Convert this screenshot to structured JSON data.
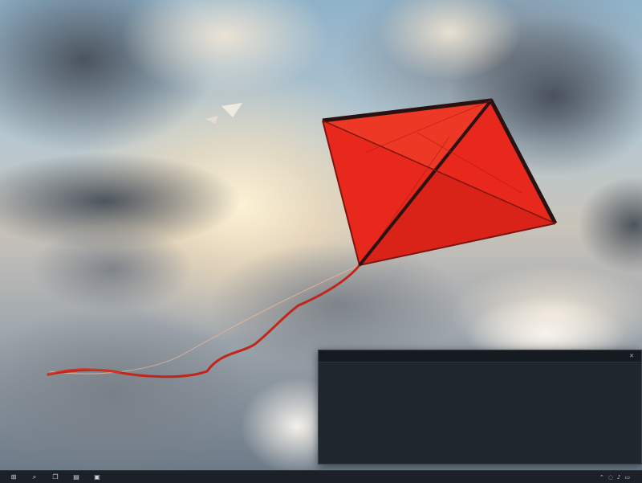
{
  "terminal": {
    "title": "",
    "close_glyph": "✕",
    "lines": [
      "",
      "",
      "",
      "",
      "",
      "",
      "",
      "",
      "",
      "",
      "",
      "",
      "",
      ""
    ]
  },
  "taskbar": {
    "start_icon": "windows-start-icon",
    "buttons": [
      {
        "name": "start-button",
        "icon": "⊞"
      },
      {
        "name": "search-button",
        "icon": "⌕"
      },
      {
        "name": "task-view-button",
        "icon": "❐"
      },
      {
        "name": "file-explorer-button",
        "icon": "▤"
      },
      {
        "name": "terminal-button",
        "icon": "▣"
      }
    ],
    "tray": {
      "chevron": "⌃",
      "network": "◌",
      "volume": "♪",
      "battery": "▭",
      "clock_time": "",
      "clock_date": ""
    }
  },
  "wallpaper": {
    "subject": "red kite in cloudy sky",
    "kite_color": "#e8281c",
    "kite_frame_color": "#2a1210",
    "sky_color": "#b7c7cf"
  }
}
